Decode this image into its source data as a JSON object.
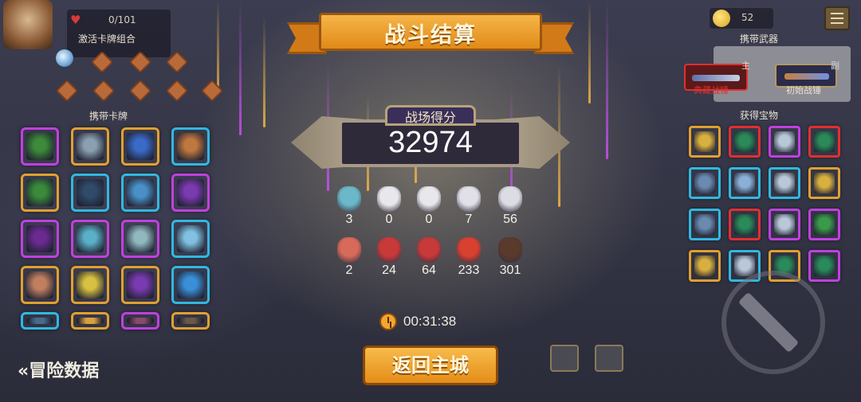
{
  "left_panel": {
    "hp": "0/101",
    "combo_title": "激活卡牌组合",
    "carry_cards_title": "携带卡牌",
    "adventure_data": "«冒险数据",
    "combo_slots": 8,
    "cards": [
      {
        "name": "card-green-cannon",
        "border": "#c040e0",
        "fill": "#3c8a3a"
      },
      {
        "name": "card-stone-turret",
        "border": "#e0a030",
        "fill": "#8aa0b0"
      },
      {
        "name": "card-blue-cannon",
        "border": "#e0a030",
        "fill": "#3a6ac8"
      },
      {
        "name": "card-orange-hero",
        "border": "#30b8e0",
        "fill": "#c07840"
      },
      {
        "name": "card-green-plant",
        "border": "#e0a030",
        "fill": "#3a8a3a"
      },
      {
        "name": "card-cyan-crystal",
        "border": "#30b8e0",
        "fill": "#304a6a"
      },
      {
        "name": "card-ice-tower",
        "border": "#30b8e0",
        "fill": "#4a90c8"
      },
      {
        "name": "card-purple-orb",
        "border": "#c040e0",
        "fill": "#7a3ab0"
      },
      {
        "name": "card-purple-beast",
        "border": "#c040e0",
        "fill": "#6a2a90"
      },
      {
        "name": "card-cyan-spirit",
        "border": "#c040e0",
        "fill": "#5ab0c8"
      },
      {
        "name": "card-white-shield",
        "border": "#c040e0",
        "fill": "#90b8c0"
      },
      {
        "name": "card-ice-gear",
        "border": "#30b8e0",
        "fill": "#80c0e0"
      },
      {
        "name": "card-barrel",
        "border": "#e0a030",
        "fill": "#c08060"
      },
      {
        "name": "card-yellow-lightning",
        "border": "#e0a030",
        "fill": "#d8c040"
      },
      {
        "name": "card-purple-vortex",
        "border": "#e0a030",
        "fill": "#7a3ab0"
      },
      {
        "name": "card-blue-crystal",
        "border": "#30b8e0",
        "fill": "#3a90d8"
      },
      {
        "name": "card-row5-a",
        "border": "#30b8e0",
        "fill": "#4a6a8a"
      },
      {
        "name": "card-row5-b",
        "border": "#e0a030",
        "fill": "#d8a040"
      },
      {
        "name": "card-row5-c",
        "border": "#c040e0",
        "fill": "#8a4a6a"
      },
      {
        "name": "card-row5-d",
        "border": "#e0a030",
        "fill": "#6a5a4a"
      }
    ]
  },
  "banner": {
    "title": "战斗结算"
  },
  "score": {
    "label": "战场得分",
    "value": "32974"
  },
  "enemies_row1": [
    {
      "name": "enemy-ghost-cyan",
      "count": "3",
      "color": "#6ab8c8"
    },
    {
      "name": "enemy-white-mask-gold",
      "count": "0",
      "color": "#e8e8ec"
    },
    {
      "name": "enemy-white-mask-gold-2",
      "count": "0",
      "color": "#e8e8ec"
    },
    {
      "name": "enemy-white-mask",
      "count": "7",
      "color": "#e0e0e8"
    },
    {
      "name": "enemy-white-mask-2",
      "count": "56",
      "color": "#dcdce4"
    }
  ],
  "enemies_row2": [
    {
      "name": "enemy-red-ghost",
      "count": "2",
      "color": "#d86a5a"
    },
    {
      "name": "enemy-red-demon",
      "count": "24",
      "color": "#c83a3a"
    },
    {
      "name": "enemy-red-demon-2",
      "count": "64",
      "color": "#c83a3a"
    },
    {
      "name": "enemy-red-hair",
      "count": "233",
      "color": "#d84030"
    },
    {
      "name": "enemy-dark-hair",
      "count": "301",
      "color": "#5a3a2a"
    }
  ],
  "timer": {
    "value": "00:31:38"
  },
  "return_button": "返回主城",
  "right_panel": {
    "coins": "52",
    "weapons_title": "携带武器",
    "main_tag": "主",
    "sub_tag": "副",
    "main_weapon": "典藏战锤",
    "sub_weapon": "初始战锤",
    "treasure_title": "获得宝物",
    "treasures": [
      {
        "name": "treasure-gold-sword",
        "border": "#e0a030",
        "fill": "#d8b040"
      },
      {
        "name": "treasure-green-dragon",
        "border": "#e03030",
        "fill": "#2a8a5a"
      },
      {
        "name": "treasure-silver-helm",
        "border": "#c040e0",
        "fill": "#b8c8d8"
      },
      {
        "name": "treasure-green-dragon-2",
        "border": "#e03030",
        "fill": "#2a8a5a"
      },
      {
        "name": "treasure-blue-chest",
        "border": "#30b8e0",
        "fill": "#6a8ab0"
      },
      {
        "name": "treasure-blue-axe",
        "border": "#30b8e0",
        "fill": "#8ab0d8"
      },
      {
        "name": "treasure-silver-helm-2",
        "border": "#30b8e0",
        "fill": "#b8c8d8"
      },
      {
        "name": "treasure-gold-sword-2",
        "border": "#e0a030",
        "fill": "#d8b040"
      },
      {
        "name": "treasure-blue-chest-2",
        "border": "#30b8e0",
        "fill": "#6a8ab0"
      },
      {
        "name": "treasure-green-dragon-3",
        "border": "#e03030",
        "fill": "#2a8a5a"
      },
      {
        "name": "treasure-silver-helm-3",
        "border": "#c040e0",
        "fill": "#b8c8d8"
      },
      {
        "name": "treasure-green-mask",
        "border": "#c040e0",
        "fill": "#3a9a4a"
      },
      {
        "name": "treasure-gold-sword-3",
        "border": "#e0a030",
        "fill": "#d8b040"
      },
      {
        "name": "treasure-silver-helm-4",
        "border": "#30b8e0",
        "fill": "#b8c8d8"
      },
      {
        "name": "treasure-green-dragon-4",
        "border": "#e0a030",
        "fill": "#2a8a5a"
      },
      {
        "name": "treasure-green-dragon-5",
        "border": "#c040e0",
        "fill": "#2a8a5a"
      }
    ]
  },
  "colors": {
    "accent_orange": "#f0a030",
    "score_frame": "#a89a86",
    "panel_bg": "#2e2a3a"
  }
}
